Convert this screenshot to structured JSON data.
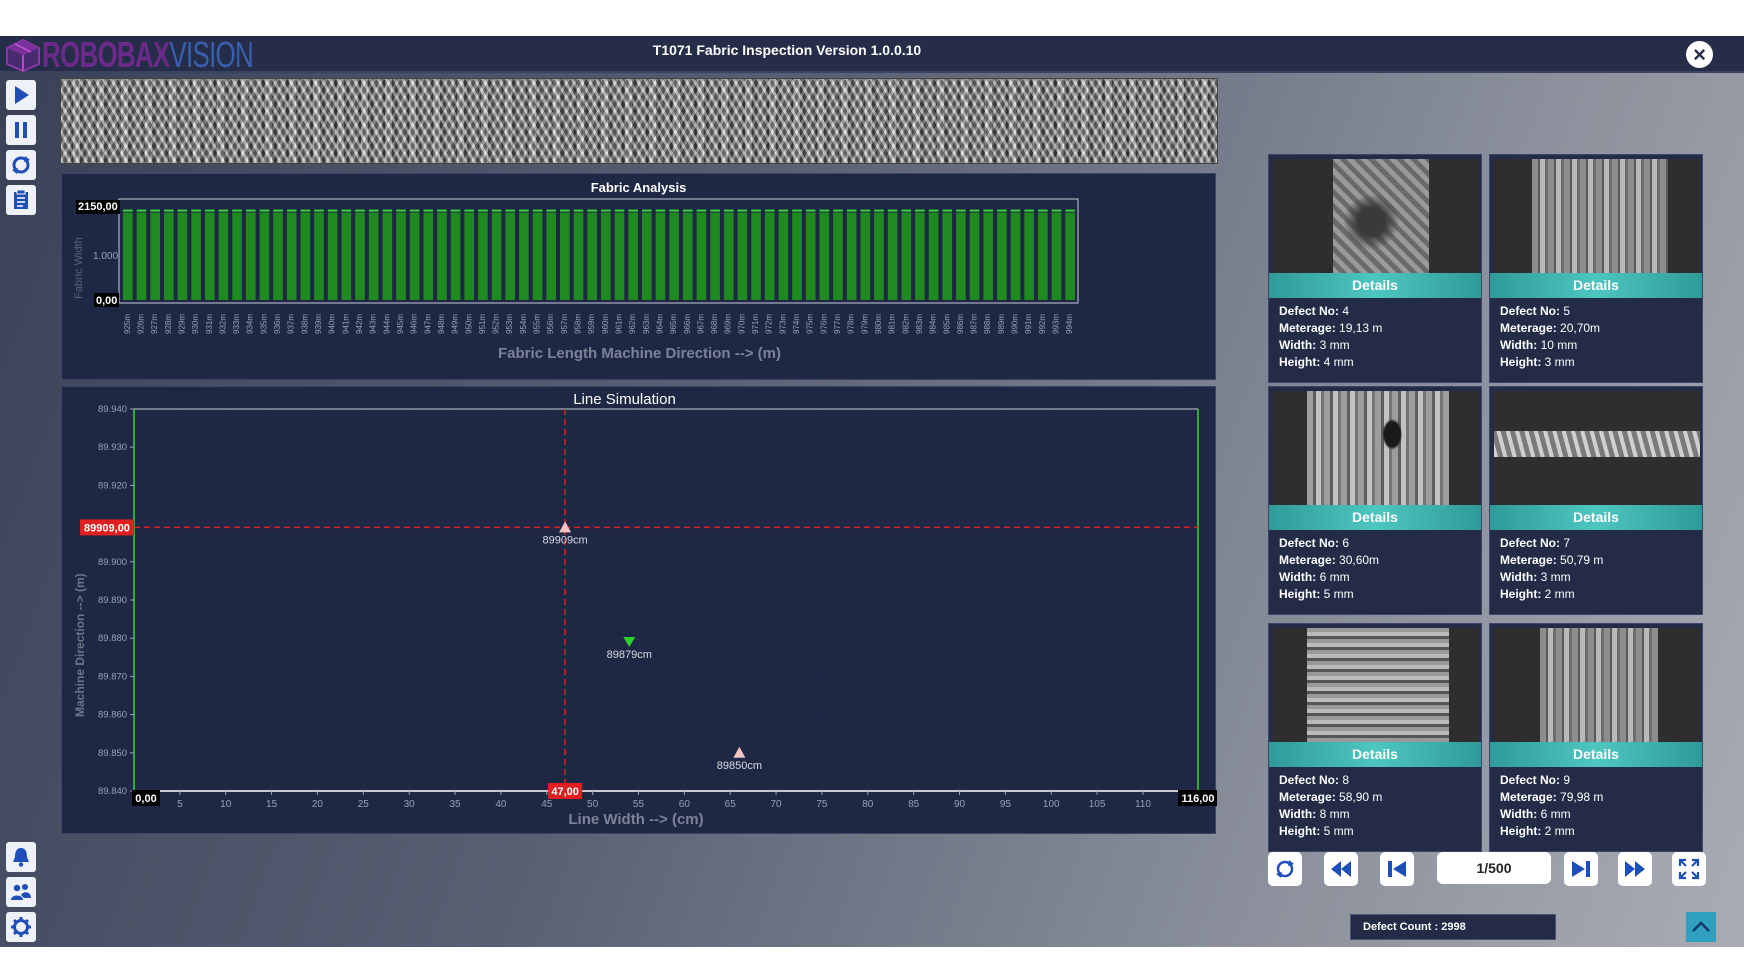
{
  "app": {
    "logo_text": "ROBOBAX",
    "logo_text_suffix": "VISION",
    "title": "T1071 Fabric Inspection Version 1.0.0.10"
  },
  "toolbar": {
    "top_icons": [
      "play-icon",
      "pause-icon",
      "refresh-icon",
      "report-icon"
    ],
    "bottom_icons": [
      "notification-icon",
      "users-icon",
      "settings-icon"
    ]
  },
  "analysis": {
    "title": "Fabric Analysis",
    "xlabel": "Fabric Length Machine Direction --> (m)",
    "ylabel": "Fabric Width",
    "y_max_label": "2150,00",
    "y_mid_label": "1.000",
    "y_min_label": "0,00"
  },
  "simulation": {
    "title": "Line Simulation",
    "xlabel": "Line Width --> (cm)",
    "ylabel": "Machine Direction --> (m)",
    "x_min_label": "0,00",
    "x_max_label": "116,00",
    "cursor_x_label": "47,00",
    "cursor_y_label": "89909,00"
  },
  "chart_data": [
    {
      "type": "bar",
      "title": "Fabric Analysis",
      "xlabel": "Fabric Length Machine Direction --> (m)",
      "ylabel": "Fabric Width",
      "categories": [
        "925m",
        "926m",
        "927m",
        "928m",
        "929m",
        "930m",
        "931m",
        "932m",
        "933m",
        "934m",
        "935m",
        "936m",
        "937m",
        "938m",
        "939m",
        "940m",
        "941m",
        "942m",
        "943m",
        "944m",
        "945m",
        "946m",
        "947m",
        "948m",
        "949m",
        "950m",
        "951m",
        "952m",
        "953m",
        "954m",
        "955m",
        "956m",
        "957m",
        "958m",
        "959m",
        "960m",
        "961m",
        "962m",
        "963m",
        "964m",
        "965m",
        "966m",
        "967m",
        "968m",
        "969m",
        "970m",
        "971m",
        "972m",
        "973m",
        "974m",
        "975m",
        "976m",
        "977m",
        "978m",
        "979m",
        "980m",
        "981m",
        "982m",
        "983m",
        "984m",
        "985m",
        "986m",
        "987m",
        "988m",
        "989m",
        "990m",
        "991m",
        "992m",
        "993m",
        "994m"
      ],
      "values": [
        2000,
        2000,
        2000,
        2000,
        2000,
        2000,
        2000,
        2000,
        2000,
        2000,
        2000,
        2000,
        2000,
        2000,
        2000,
        2000,
        2000,
        2000,
        2000,
        2000,
        2000,
        2000,
        2000,
        2000,
        2000,
        2000,
        2000,
        2000,
        2000,
        2000,
        2000,
        2000,
        2000,
        2000,
        2000,
        2000,
        2000,
        2000,
        2000,
        2000,
        2000,
        2000,
        2000,
        2000,
        2000,
        2000,
        2000,
        2000,
        2000,
        2000,
        2000,
        2000,
        2000,
        2000,
        2000,
        2000,
        2000,
        2000,
        2000,
        2000,
        2000,
        2000,
        2000,
        2000,
        2000,
        2000,
        2000,
        2000,
        2000,
        2000
      ],
      "ylim": [
        0,
        2150
      ],
      "bar_color": "#1f8a1f",
      "cap_color": "#3bd13b"
    },
    {
      "type": "scatter",
      "title": "Line Simulation",
      "xlabel": "Line Width --> (cm)",
      "ylabel": "Machine Direction --> (m)",
      "xlim": [
        0,
        116
      ],
      "ylim": [
        89840,
        89940
      ],
      "x_ticks": [
        5,
        10,
        15,
        20,
        25,
        30,
        35,
        40,
        45,
        50,
        55,
        60,
        65,
        70,
        75,
        80,
        85,
        90,
        95,
        100,
        105,
        110
      ],
      "y_ticks": [
        "89.840",
        "89.850",
        "89.860",
        "89.870",
        "89.880",
        "89.890",
        "89.900",
        "89.910",
        "89.920",
        "89.930",
        "89.940"
      ],
      "points": [
        {
          "x": 47,
          "y": 89909,
          "label": "89909cm",
          "marker": "up-triangle",
          "color": "#f3c4c4"
        },
        {
          "x": 54,
          "y": 89879,
          "label": "89879cm",
          "marker": "down-triangle",
          "color": "#2ed12e"
        },
        {
          "x": 66,
          "y": 89850,
          "label": "89850cm",
          "marker": "up-triangle",
          "color": "#f3c4c4"
        }
      ],
      "cursor": {
        "x": 47,
        "y": 89909
      }
    }
  ],
  "defects": [
    {
      "button": "Details",
      "no_label": "Defect No:",
      "no": "4",
      "meterage_label": "Meterage:",
      "meterage": "19,13 m",
      "width_label": "Width:",
      "width": "3 mm",
      "height_label": "Height:",
      "height": "4 mm"
    },
    {
      "button": "Details",
      "no_label": "Defect No:",
      "no": "5",
      "meterage_label": "Meterage:",
      "meterage": "20,70m",
      "width_label": "Width:",
      "width": "10 mm",
      "height_label": "Height:",
      "height": "3 mm"
    },
    {
      "button": "Details",
      "no_label": "Defect No:",
      "no": "6",
      "meterage_label": "Meterage:",
      "meterage": "30,60m",
      "width_label": "Width:",
      "width": "6 mm",
      "height_label": "Height:",
      "height": "5 mm"
    },
    {
      "button": "Details",
      "no_label": "Defect No:",
      "no": "7",
      "meterage_label": "Meterage:",
      "meterage": "50,79 m",
      "width_label": "Width:",
      "width": "3 mm",
      "height_label": "Height:",
      "height": "2 mm"
    },
    {
      "button": "Details",
      "no_label": "Defect No:",
      "no": "8",
      "meterage_label": "Meterage:",
      "meterage": "58,90 m",
      "width_label": "Width:",
      "width": "8 mm",
      "height_label": "Height:",
      "height": "5 mm"
    },
    {
      "button": "Details",
      "no_label": "Defect No:",
      "no": "9",
      "meterage_label": "Meterage:",
      "meterage": "79,98 m",
      "width_label": "Width:",
      "width": "6 mm",
      "height_label": "Height:",
      "height": "2 mm"
    }
  ],
  "pager": {
    "page": "1/500",
    "icons": [
      "refresh-icon",
      "fast-backward-icon",
      "skip-first-icon",
      "skip-last-icon",
      "fast-forward-icon",
      "fullscreen-icon"
    ]
  },
  "status": {
    "defect_count": "Defect Count : 2998"
  },
  "colors": {
    "titlebar": "#252d48",
    "panel": "#1e2744",
    "accent_teal": "#3fb8b4",
    "cursor_red": "#e02020"
  }
}
